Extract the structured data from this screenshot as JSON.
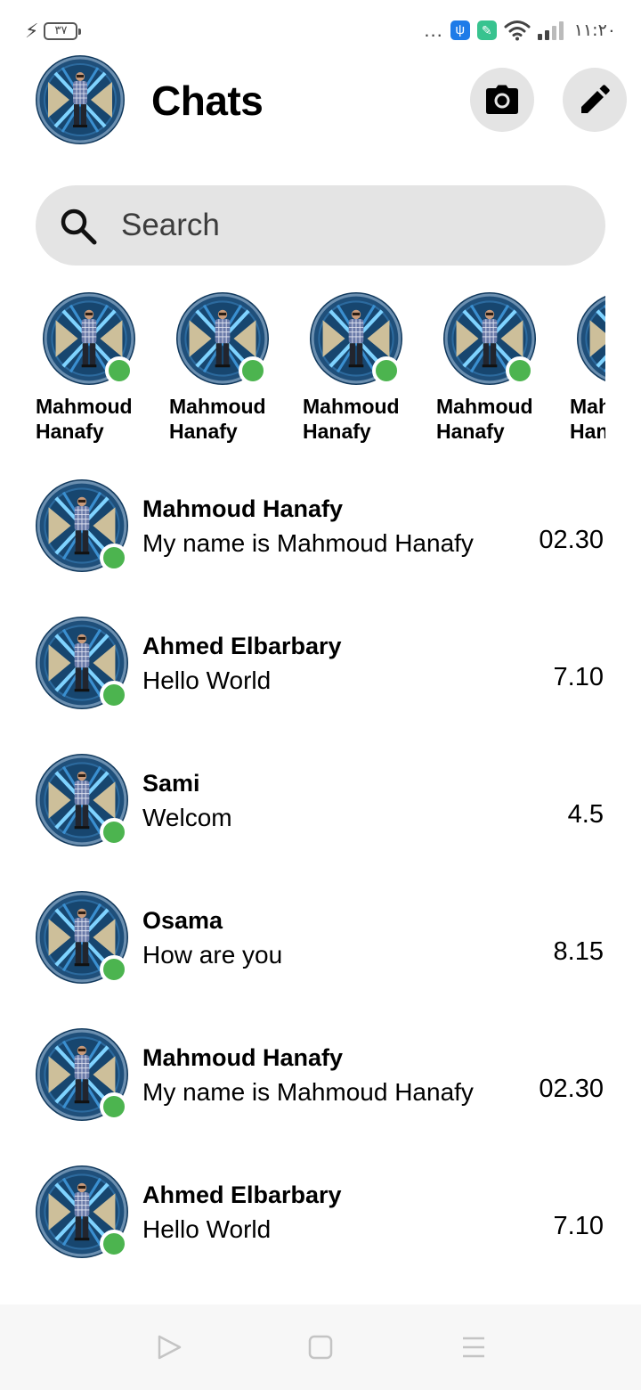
{
  "status_bar": {
    "battery_level": "٣٧",
    "more_icon": "...",
    "time": "١١:٢٠",
    "usb_icon": "usb-icon",
    "app_icon": "app-notification-icon",
    "signal_bars": 4,
    "signal_active": 2
  },
  "header": {
    "title": "Chats",
    "camera_icon": "camera-icon",
    "edit_icon": "pencil-icon"
  },
  "search": {
    "placeholder": "Search",
    "value": ""
  },
  "stories": [
    {
      "first": "Mahmoud",
      "last": "Hanafy",
      "online": true
    },
    {
      "first": "Mahmoud",
      "last": "Hanafy",
      "online": true
    },
    {
      "first": "Mahmoud",
      "last": "Hanafy",
      "online": true
    },
    {
      "first": "Mahmoud",
      "last": "Hanafy",
      "online": true
    },
    {
      "first": "Mahmoud",
      "last": "Hanafy",
      "online": true
    }
  ],
  "chats": [
    {
      "name": "Mahmoud Hanafy",
      "message": "My name is Mahmoud Hanafy",
      "time": "02.30",
      "online": true
    },
    {
      "name": "Ahmed Elbarbary",
      "message": "Hello World",
      "time": "7.10",
      "online": true
    },
    {
      "name": "Sami",
      "message": "Welcom",
      "time": "4.5",
      "online": true
    },
    {
      "name": "Osama",
      "message": "How are you",
      "time": "8.15",
      "online": true
    },
    {
      "name": "Mahmoud Hanafy",
      "message": "My name is Mahmoud Hanafy",
      "time": "02.30",
      "online": true
    },
    {
      "name": "Ahmed Elbarbary",
      "message": "Hello World",
      "time": "7.10",
      "online": true
    }
  ],
  "colors": {
    "online": "#4cb44f",
    "button_bg": "#e4e4e4",
    "avatar_bg": "#1f4f7a"
  },
  "nav": {
    "back_icon": "triangle-back-icon",
    "home_icon": "square-home-icon",
    "menu_icon": "menu-lines-icon"
  }
}
